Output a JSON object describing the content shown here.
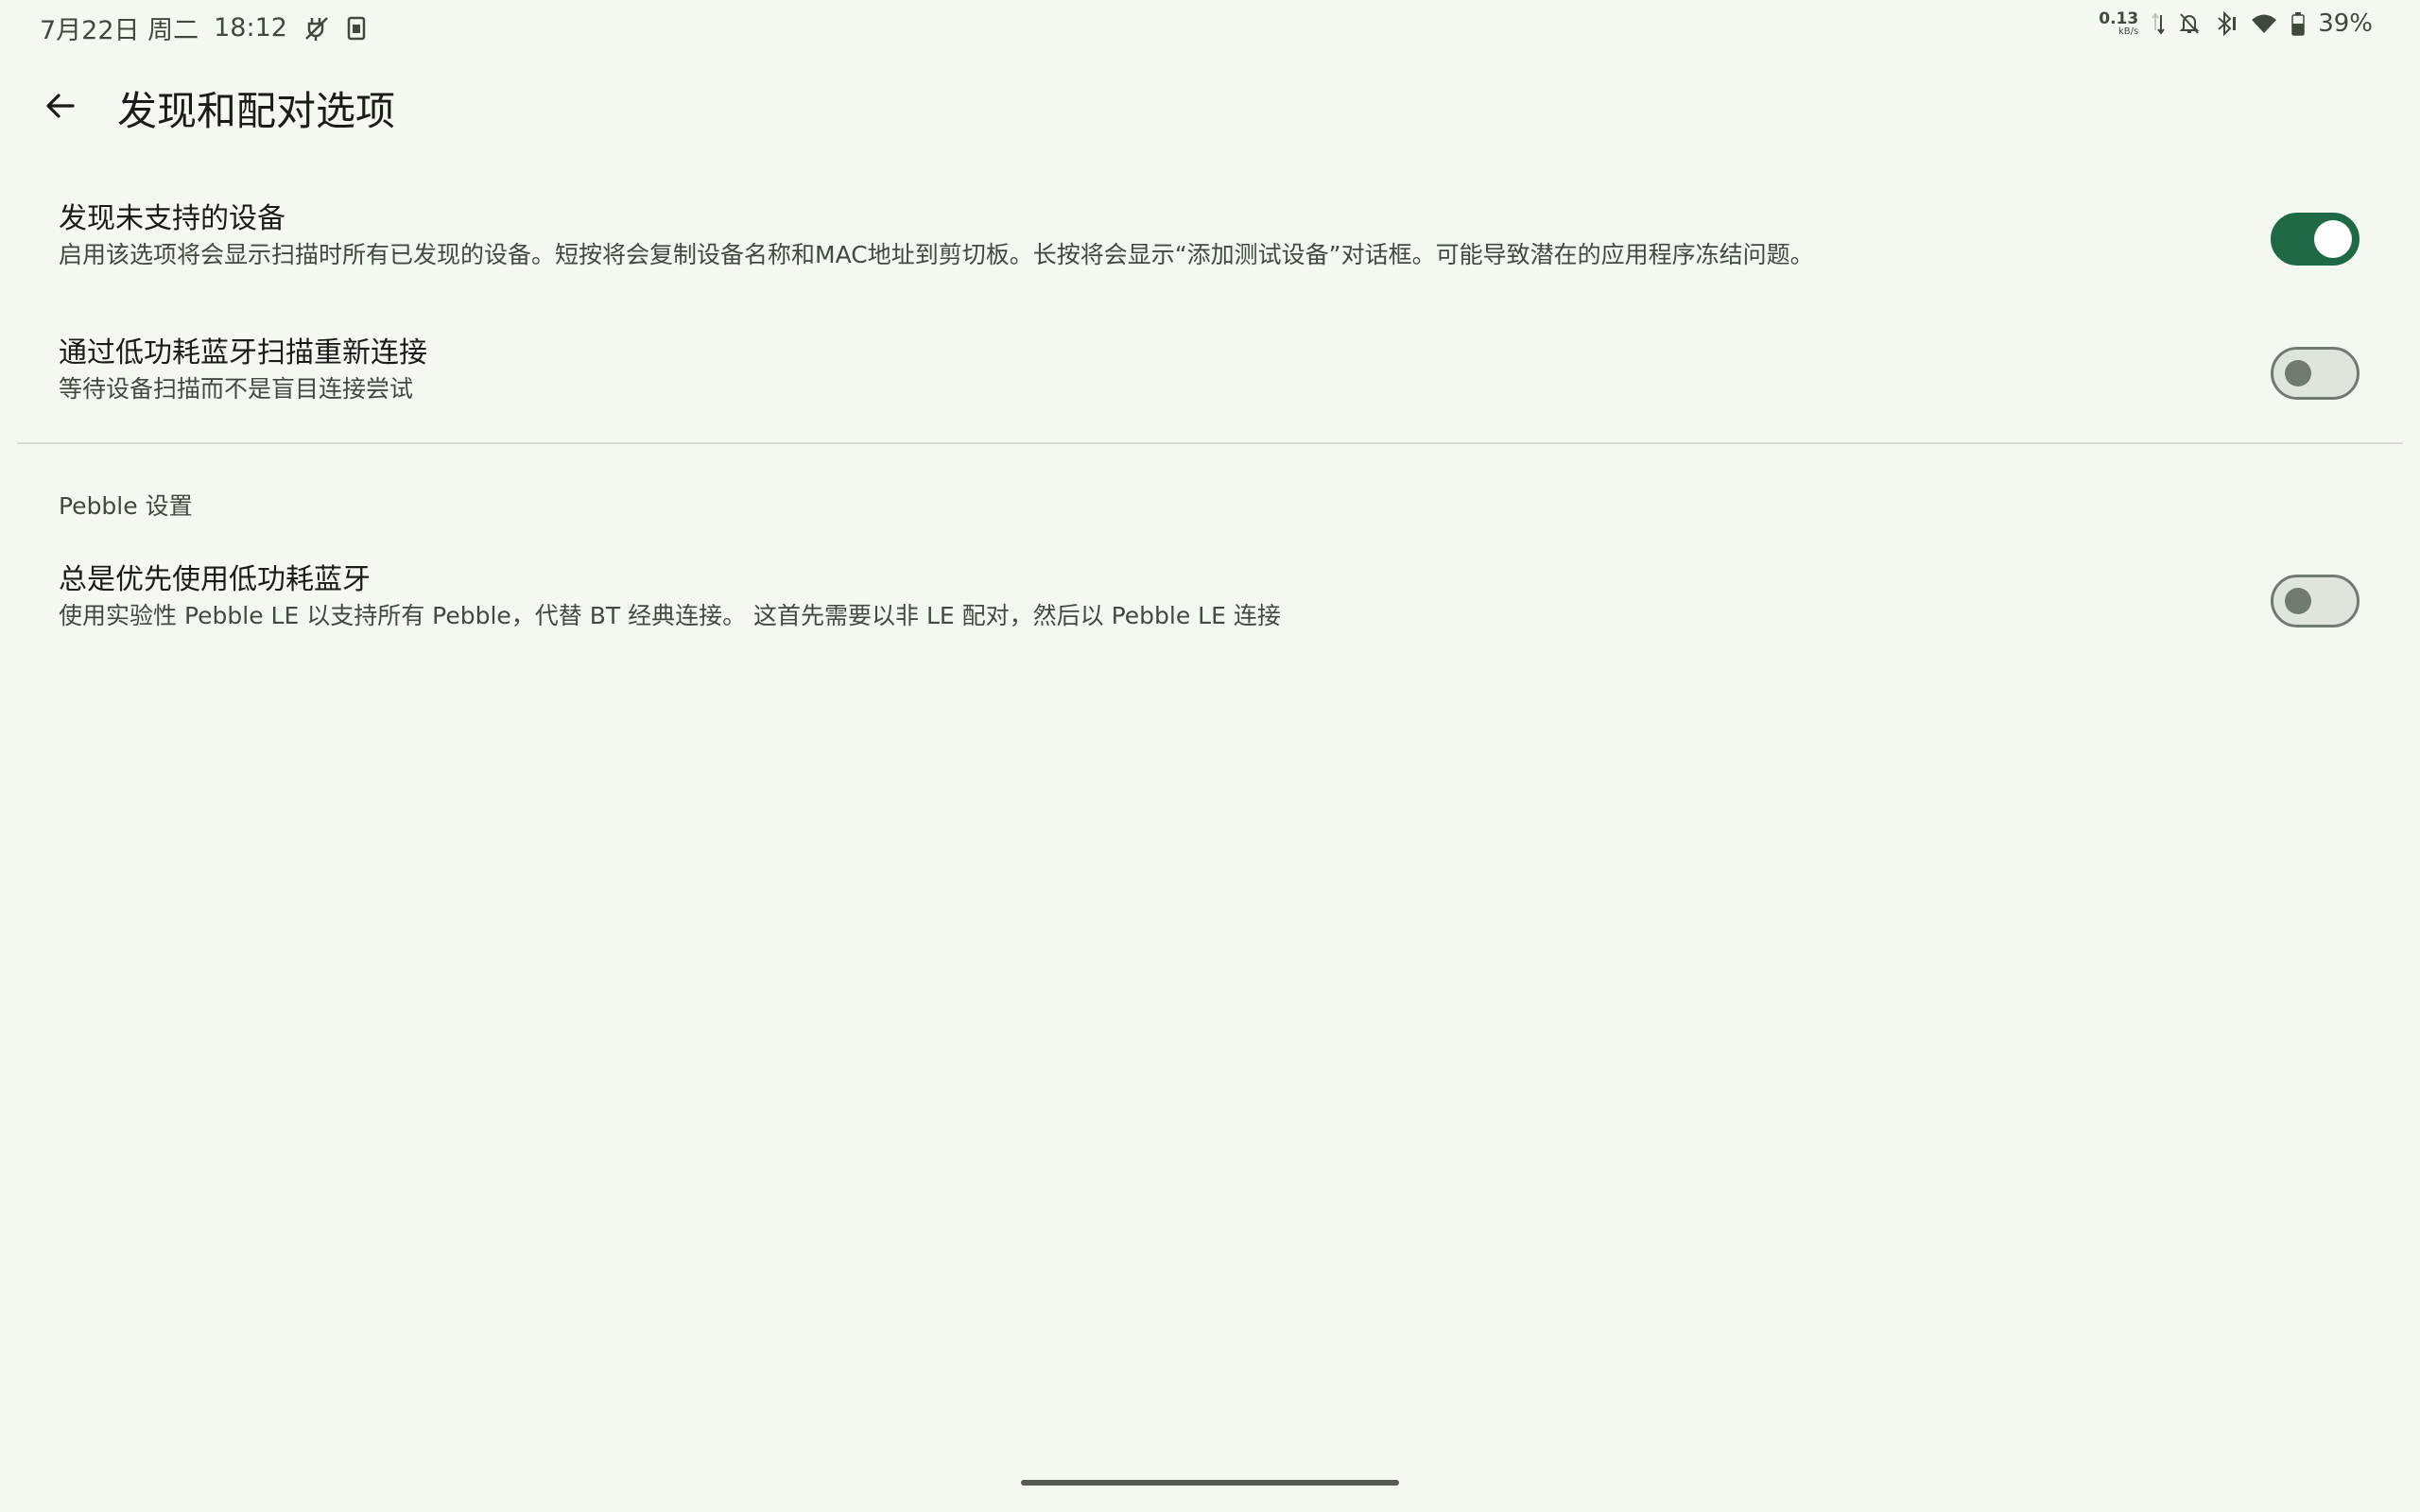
{
  "status_bar": {
    "date": "7月22日 周二",
    "time": "18:12",
    "net_speed_value": "0.13",
    "net_speed_unit": "kB/s",
    "battery": "39%"
  },
  "app_bar": {
    "title": "发现和配对选项"
  },
  "preferences": [
    {
      "title": "发现未支持的设备",
      "summary": "启用该选项将会显示扫描时所有已发现的设备。短按将会复制设备名称和MAC地址到剪切板。长按将会显示“添加测试设备”对话框。可能导致潜在的应用程序冻结问题。",
      "enabled": true
    },
    {
      "title": "通过低功耗蓝牙扫描重新连接",
      "summary": "等待设备扫描而不是盲目连接尝试",
      "enabled": false
    }
  ],
  "pebble_section": {
    "header": "Pebble 设置",
    "items": [
      {
        "title": "总是优先使用低功耗蓝牙",
        "summary": "使用实验性 Pebble LE 以支持所有 Pebble，代替 BT 经典连接。 这首先需要以非 LE 配对，然后以 Pebble LE 连接",
        "enabled": false
      }
    ]
  },
  "colors": {
    "background": "#f3f9f1",
    "accent": "#1f6a45",
    "switch_off_outline": "#707a6e"
  }
}
